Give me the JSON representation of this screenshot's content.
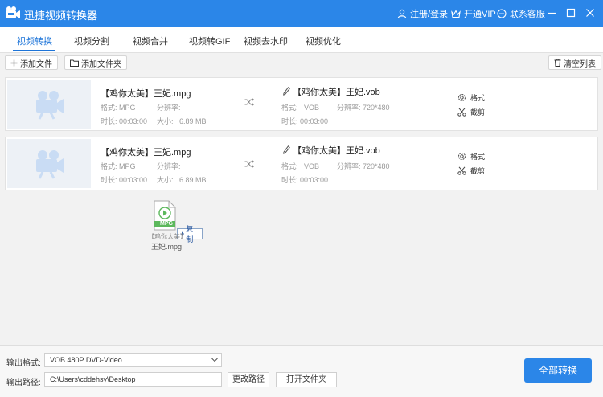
{
  "app": {
    "title": "迅捷视频转换器",
    "login_label": "注册/登录",
    "vip_label": "开通VIP",
    "service_label": "联系客服"
  },
  "tabs": [
    "视频转换",
    "视频分割",
    "视频合并",
    "视频转GIF",
    "视频去水印",
    "视频优化"
  ],
  "toolbar": {
    "add_file": "添加文件",
    "add_folder": "添加文件夹",
    "clear_list": "清空列表"
  },
  "labels": {
    "format": "格式:",
    "resolution": "分辨率:",
    "duration": "时长:",
    "size": "大小:",
    "format_action": "格式",
    "cut_action": "截剪"
  },
  "files": [
    {
      "source_name": "【鸡你太美】王妃.mpg",
      "source_format": "MPG",
      "source_duration": "00:03:00",
      "source_size": "6.89 MB",
      "target_name": "【鸡你太美】王妃.vob",
      "target_format": "VOB",
      "target_resolution": "720*480",
      "target_duration": "00:03:00"
    },
    {
      "source_name": "【鸡你太美】王妃.mpg",
      "source_format": "MPG",
      "source_duration": "00:03:00",
      "source_size": "6.89 MB",
      "target_name": "【鸡你太美】王妃.vob",
      "target_format": "VOB",
      "target_resolution": "720*480",
      "target_duration": "00:03:00"
    }
  ],
  "drag": {
    "badge": "MPG",
    "copy_label": "复制",
    "name_line1": "【鸡你太美】",
    "name_line2": "王妃.mpg"
  },
  "output": {
    "format_label": "输出格式:",
    "format_value": "VOB  480P DVD-Video",
    "path_label": "输出路径:",
    "path_value": "C:\\Users\\cddehsy\\Desktop",
    "change_path": "更改路径",
    "open_folder": "打开文件夹",
    "convert_all": "全部转换"
  },
  "colors": {
    "titlebar": "#2b86e8",
    "accent": "#1d74d8",
    "thumb_bg": "#edf1f6",
    "thumb_icon": "#c9dcf4"
  }
}
